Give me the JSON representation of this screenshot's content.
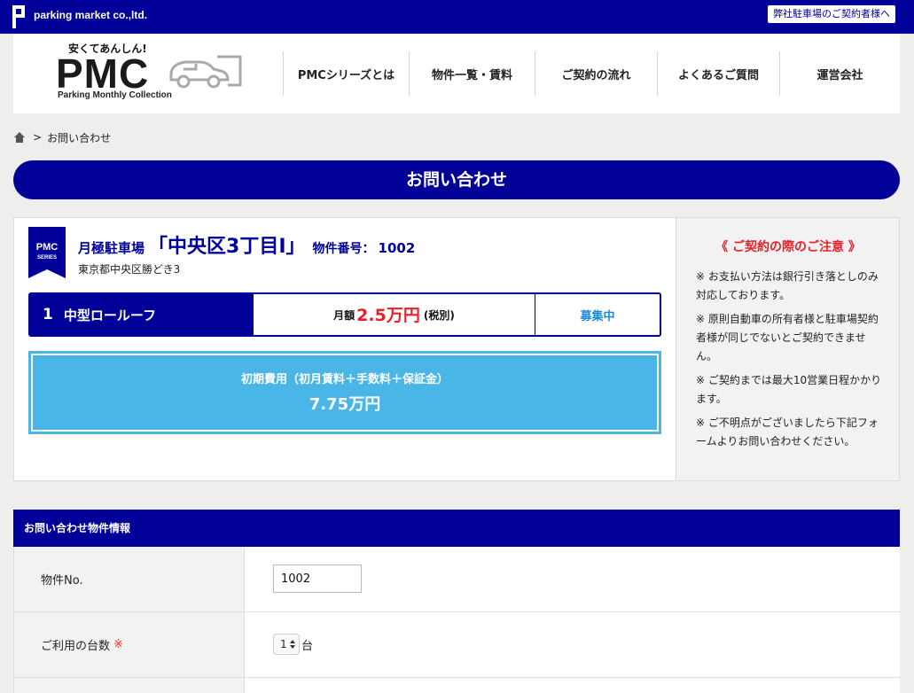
{
  "topbar": {
    "company": "parking market co.,ltd.",
    "owner_link": "弊社駐車場のご契約者様へ"
  },
  "logo": {
    "tagline": "安くてあんしん!",
    "mark": "PMC",
    "subtitle": "Parking Monthly Collection"
  },
  "nav": [
    {
      "label": "PMCシリーズとは"
    },
    {
      "label": "物件一覧・賃料"
    },
    {
      "label": "ご契約の流れ"
    },
    {
      "label": "よくあるご質問"
    },
    {
      "label": "運営会社"
    }
  ],
  "breadcrumb": {
    "separator": ">",
    "current": "お問い合わせ"
  },
  "page_title": "お問い合わせ",
  "property": {
    "badge_line1": "PMC",
    "badge_line2": "SERIES",
    "type": "月極駐車場",
    "name": "「中央区3丁目I」",
    "number_label": "物件番号：",
    "number": "1002",
    "address": "東京都中央区勝どき3",
    "space": {
      "no": "1",
      "type": "中型ロールーフ",
      "price_label": "月額",
      "price": "2.5万円",
      "tax": "(税別)",
      "status": "募集中"
    },
    "initial_cost": {
      "label": "初期費用（初月賃料＋手数料＋保証金）",
      "value": "7.75万円"
    }
  },
  "notice": {
    "title": "《 ご契約の際のご注意 》",
    "items": [
      "※ お支払い方法は銀行引き落としのみ対応しております。",
      "※ 原則自動車の所有者様と駐車場契約者様が同じでないとご契約できません。",
      "※ ご契約までは最大10営業日程かかります。",
      "※ ご不明点がございましたら下記フォームよりお問い合わせください。"
    ]
  },
  "form": {
    "header": "お問い合わせ物件情報",
    "property_no_label": "物件No.",
    "property_no_value": "1002",
    "count_label": "ご利用の台数",
    "required_mark": "※",
    "count_value": "1",
    "count_unit": "台"
  },
  "colors": {
    "brand": "#000099",
    "accent_red": "#e8202a",
    "sky": "#4ab6e8",
    "status_blue": "#1d8ad8"
  }
}
